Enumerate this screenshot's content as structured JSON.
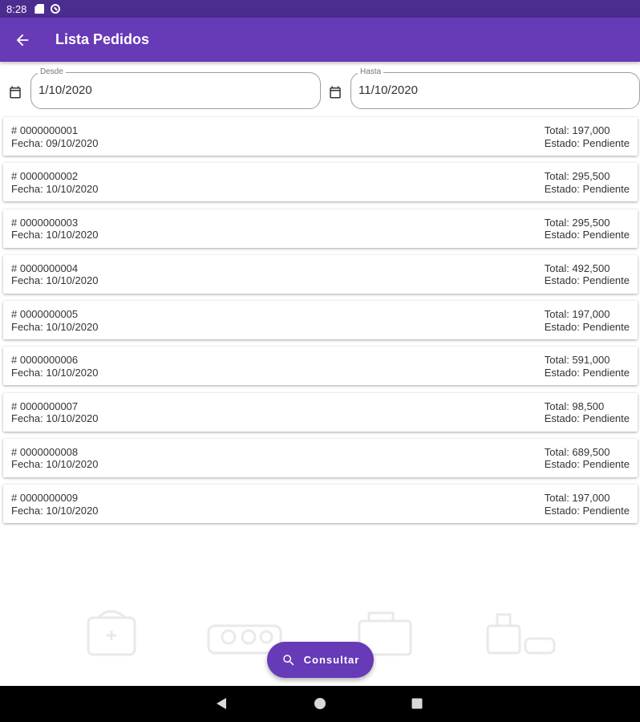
{
  "status_bar": {
    "time": "8:28",
    "icons": [
      "sd-card-icon",
      "sync-disabled-icon"
    ]
  },
  "app_bar": {
    "title": "Lista Pedidos",
    "back_icon": "arrow-back-icon",
    "color": "#673ab7"
  },
  "filters": {
    "desde": {
      "label": "Desde",
      "value": "1/10/2020",
      "icon": "calendar-icon"
    },
    "hasta": {
      "label": "Hasta",
      "value": "11/10/2020",
      "icon": "calendar-icon"
    }
  },
  "orders": [
    {
      "number": "# 0000000001",
      "date": "Fecha: 09/10/2020",
      "total": "Total: 197,000",
      "status": "Estado: Pendiente"
    },
    {
      "number": "# 0000000002",
      "date": "Fecha: 10/10/2020",
      "total": "Total: 295,500",
      "status": "Estado: Pendiente"
    },
    {
      "number": "# 0000000003",
      "date": "Fecha: 10/10/2020",
      "total": "Total: 295,500",
      "status": "Estado: Pendiente"
    },
    {
      "number": "# 0000000004",
      "date": "Fecha: 10/10/2020",
      "total": "Total: 492,500",
      "status": "Estado: Pendiente"
    },
    {
      "number": "# 0000000005",
      "date": "Fecha: 10/10/2020",
      "total": "Total: 197,000",
      "status": "Estado: Pendiente"
    },
    {
      "number": "# 0000000006",
      "date": "Fecha: 10/10/2020",
      "total": "Total: 591,000",
      "status": "Estado: Pendiente"
    },
    {
      "number": "# 0000000007",
      "date": "Fecha: 10/10/2020",
      "total": "Total: 98,500",
      "status": "Estado: Pendiente"
    },
    {
      "number": "# 0000000008",
      "date": "Fecha: 10/10/2020",
      "total": "Total: 689,500",
      "status": "Estado: Pendiente"
    },
    {
      "number": "# 0000000009",
      "date": "Fecha: 10/10/2020",
      "total": "Total: 197,000",
      "status": "Estado: Pendiente"
    }
  ],
  "fab": {
    "label": "Consultar",
    "icon": "search-icon"
  },
  "nav_bar": {
    "icons": [
      "nav-back-icon",
      "nav-home-icon",
      "nav-recents-icon"
    ]
  }
}
